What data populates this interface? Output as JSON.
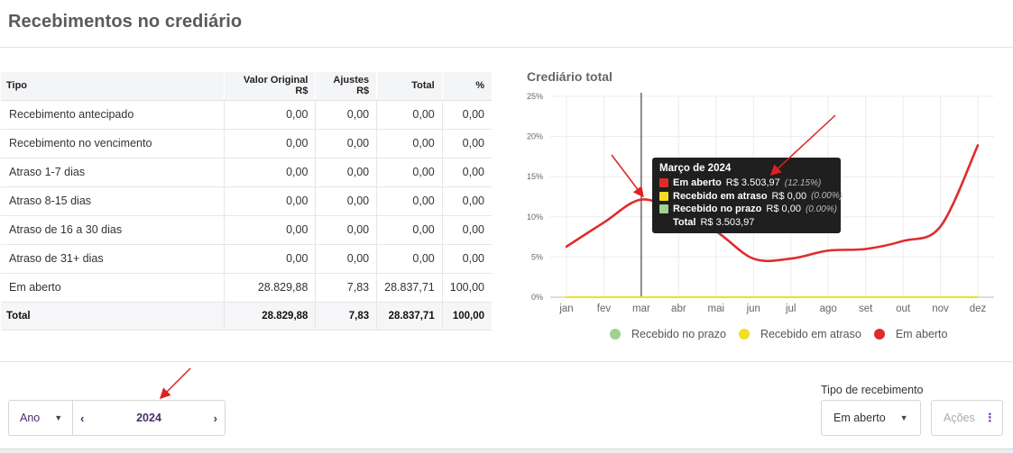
{
  "page": {
    "title": "Recebimentos no crediário"
  },
  "table": {
    "headers": [
      "Tipo",
      "Valor Original R$",
      "Ajustes R$",
      "Total",
      "%"
    ],
    "rows": [
      [
        "Recebimento antecipado",
        "0,00",
        "0,00",
        "0,00",
        "0,00"
      ],
      [
        "Recebimento no vencimento",
        "0,00",
        "0,00",
        "0,00",
        "0,00"
      ],
      [
        "Atraso 1-7 dias",
        "0,00",
        "0,00",
        "0,00",
        "0,00"
      ],
      [
        "Atraso 8-15 dias",
        "0,00",
        "0,00",
        "0,00",
        "0,00"
      ],
      [
        "Atraso de 16 a 30 dias",
        "0,00",
        "0,00",
        "0,00",
        "0,00"
      ],
      [
        "Atraso de 31+ dias",
        "0,00",
        "0,00",
        "0,00",
        "0,00"
      ],
      [
        "Em aberto",
        "28.829,88",
        "7,83",
        "28.837,71",
        "100,00"
      ]
    ],
    "total": [
      "Total",
      "28.829,88",
      "7,83",
      "28.837,71",
      "100,00"
    ]
  },
  "chart_data": {
    "type": "line",
    "title": "Crediário total",
    "categories": [
      "jan",
      "fev",
      "mar",
      "abr",
      "mai",
      "jun",
      "jul",
      "ago",
      "set",
      "out",
      "nov",
      "dez"
    ],
    "y_ticks": [
      "0%",
      "5%",
      "10%",
      "15%",
      "20%",
      "25%"
    ],
    "ylim": [
      0,
      25
    ],
    "grid": true,
    "legend_position": "bottom",
    "series": [
      {
        "name": "Recebido no prazo",
        "color": "#a1d18f",
        "values": [
          0,
          0,
          0,
          0,
          0,
          0,
          0,
          0,
          0,
          0,
          0,
          0
        ]
      },
      {
        "name": "Recebido em atraso",
        "color": "#f2df1f",
        "values": [
          0,
          0,
          0,
          0,
          0,
          0,
          0,
          0,
          0,
          0,
          0,
          0
        ]
      },
      {
        "name": "Em aberto",
        "color": "#e02b2b",
        "values": [
          6.3,
          9.3,
          12.15,
          10.5,
          8.2,
          4.8,
          4.8,
          5.8,
          6.0,
          7.0,
          8.8,
          18.9
        ]
      }
    ],
    "hover_marker": "mar"
  },
  "tooltip": {
    "title": "Março de 2024",
    "rows": [
      {
        "name": "Em aberto",
        "value": "R$ 3.503,97",
        "pct": "(12.15%)",
        "color": "#e02b2b"
      },
      {
        "name": "Recebido em atraso",
        "value": "R$ 0,00",
        "pct": "(0.00%)",
        "color": "#f2df1f"
      },
      {
        "name": "Recebido no prazo",
        "value": "R$ 0,00",
        "pct": "(0.00%)",
        "color": "#a1d18f"
      }
    ],
    "total_label": "Total",
    "total_value": "R$ 3.503,97"
  },
  "filters": {
    "period_type": "Ano",
    "year": "2024",
    "prev_icon": "chevron-left-icon",
    "next_icon": "chevron-right-icon",
    "receipt_type_label": "Tipo de recebimento",
    "receipt_type_value": "Em aberto",
    "actions_label": "Ações"
  },
  "colors": {
    "brand_purple": "#4a2d6b",
    "accent_purple": "#7a3ea8",
    "annotation_arrow": "#e02020"
  }
}
